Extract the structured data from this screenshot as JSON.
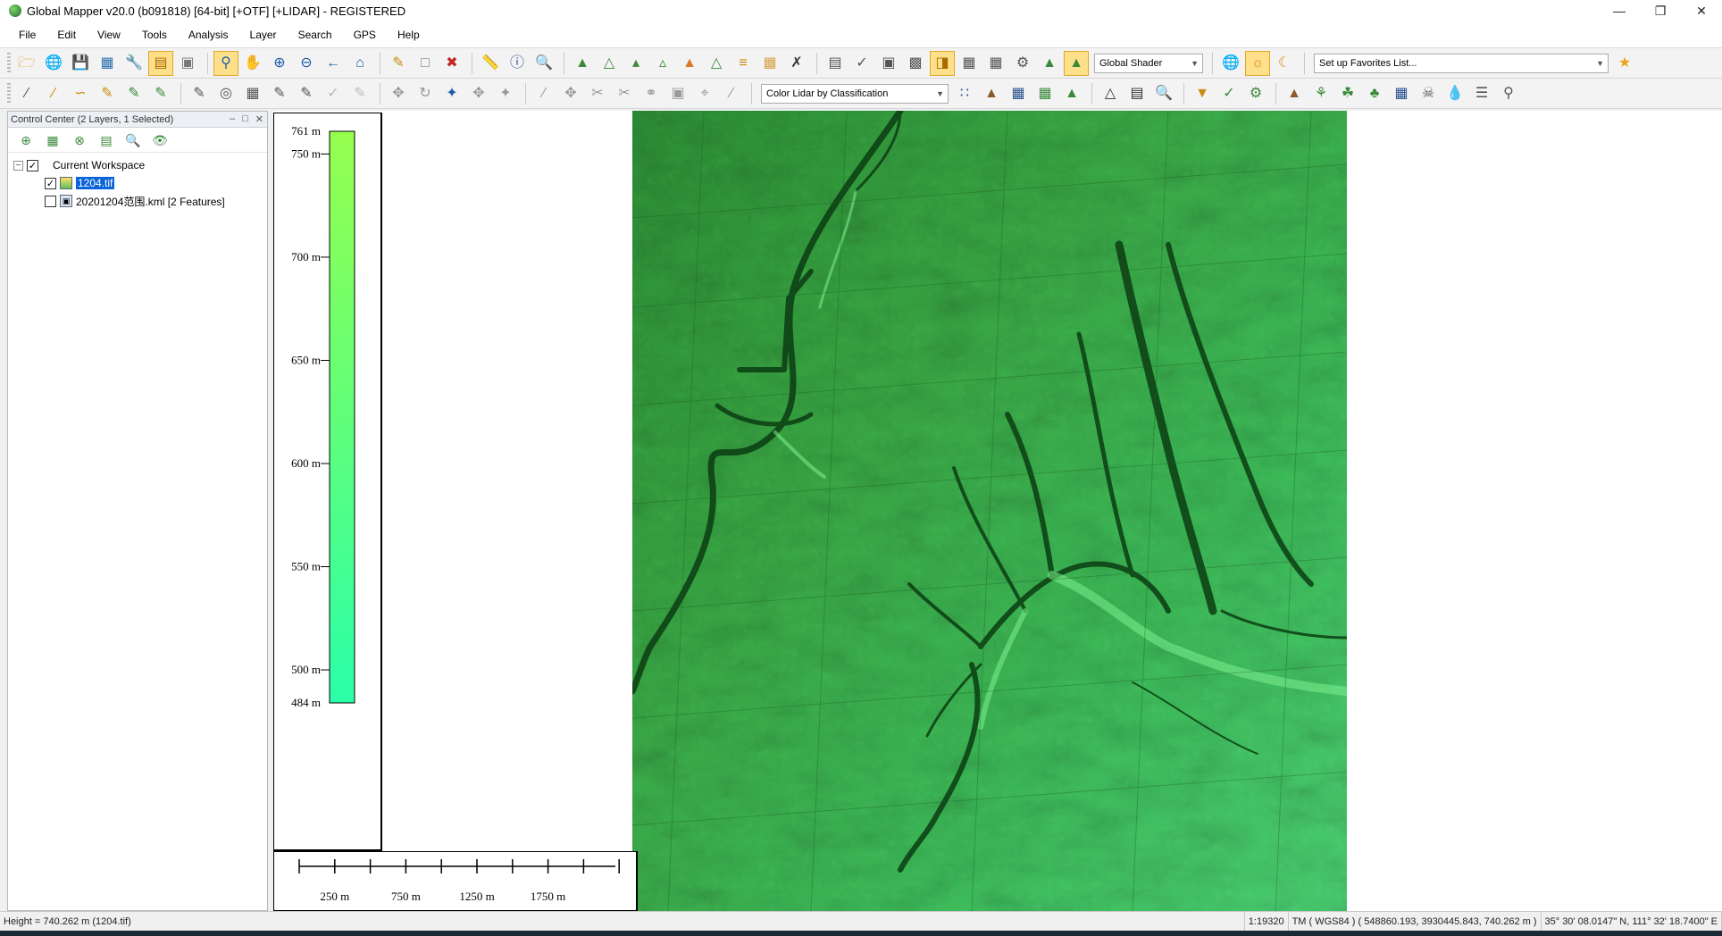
{
  "window": {
    "title": "Global Mapper v20.0 (b091818) [64-bit] [+OTF] [+LIDAR] - REGISTERED",
    "controls": [
      "minimize-icon",
      "restore-icon",
      "close-icon"
    ]
  },
  "menu": [
    "File",
    "Edit",
    "View",
    "Tools",
    "Analysis",
    "Layer",
    "Search",
    "GPS",
    "Help"
  ],
  "toolbar1": {
    "shader_select": "Global Shader",
    "favorites_select": "Set up Favorites List..."
  },
  "toolbar2": {
    "lidar_color_select": "Color Lidar by Classification"
  },
  "control_center": {
    "title": "Control Center (2 Layers, 1 Selected)",
    "workspace_label": "Current Workspace",
    "layers": [
      {
        "name": "1204.tif",
        "checked": true,
        "selected": true,
        "icon": "raster-layer-icon"
      },
      {
        "name": "20201204范围.kml [2 Features]",
        "checked": false,
        "selected": false,
        "icon": "vector-layer-icon"
      }
    ]
  },
  "elevation_legend": {
    "unit": "m",
    "max": 761,
    "min": 484,
    "max_label": "761 m",
    "min_label": "484 m",
    "ticks": [
      "750 m",
      "700 m",
      "650 m",
      "600 m",
      "550 m",
      "500 m"
    ],
    "tick_values": [
      750,
      700,
      650,
      600,
      550,
      500
    ],
    "color_top": "#96ff4e",
    "color_bottom": "#2bffa9"
  },
  "scale_bar": {
    "labels": [
      "250 m",
      "750 m",
      "1250 m",
      "1750 m"
    ],
    "units": "m"
  },
  "status": {
    "height_readout": "Height = 740.262 m (1204.tif)",
    "scale": "1:19320",
    "projection_coords": "TM ( WGS84 ) ( 548860.193, 3930445.843, 740.262 m )",
    "geo_coords": "35° 30' 08.0147\" N, 111° 32' 18.7400\" E"
  },
  "colors": {
    "terrain_dark": "#0b3d12",
    "terrain_mid": "#2f9a3a",
    "terrain_light": "#5ee07a",
    "selection": "#0a64d8"
  }
}
